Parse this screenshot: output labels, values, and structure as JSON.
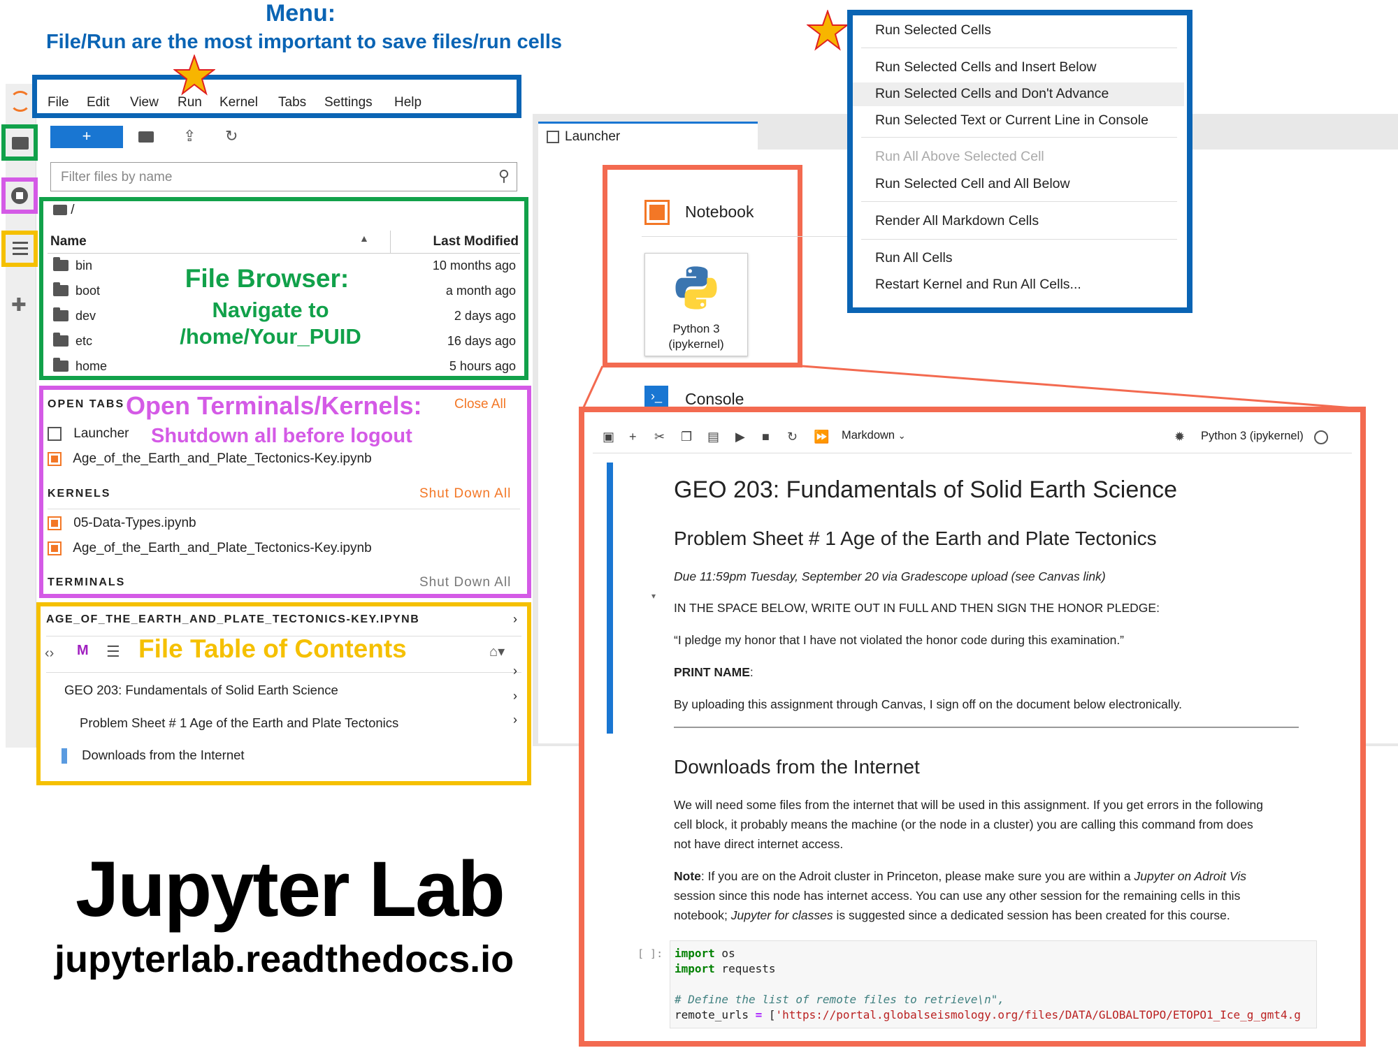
{
  "annotations": {
    "menu_title": "Menu:",
    "menu_subtitle": "File/Run are the most important to save files/run cells",
    "file_browser_title": "File Browser:",
    "file_browser_line1": "Navigate to",
    "file_browser_line2": "/home/Your_PUID",
    "terminals_title": "Open Terminals/Kernels:",
    "terminals_sub": "Shutdown all before logout",
    "toc_title": "File Table of Contents",
    "brand_title": "Jupyter Lab",
    "brand_url": "jupyterlab.readthedocs.io"
  },
  "menubar": [
    "File",
    "Edit",
    "View",
    "Run",
    "Kernel",
    "Tabs",
    "Settings",
    "Help"
  ],
  "file_browser": {
    "new_label": "+",
    "filter_placeholder": "Filter files by name",
    "path": "/",
    "col_name": "Name",
    "col_modified": "Last Modified",
    "files": [
      {
        "name": "bin",
        "modified": "10 months ago"
      },
      {
        "name": "boot",
        "modified": "a month ago"
      },
      {
        "name": "dev",
        "modified": "2 days ago"
      },
      {
        "name": "etc",
        "modified": "16 days ago"
      },
      {
        "name": "home",
        "modified": "5 hours ago"
      }
    ]
  },
  "running": {
    "open_tabs_header": "OPEN TABS",
    "close_all": "Close All",
    "open_tabs": [
      "Launcher",
      "Age_of_the_Earth_and_Plate_Tectonics-Key.ipynb"
    ],
    "kernels_header": "KERNELS",
    "shut_down_all": "Shut Down All",
    "kernels": [
      "05-Data-Types.ipynb",
      "Age_of_the_Earth_and_Plate_Tectonics-Key.ipynb"
    ],
    "terminals_header": "TERMINALS",
    "terminals_shutdown": "Shut Down All"
  },
  "toc": {
    "header": "AGE_OF_THE_EARTH_AND_PLATE_TECTONICS-KEY.IPYNB",
    "items": [
      "GEO 203: Fundamentals of Solid Earth Science",
      "Problem Sheet # 1 Age of the Earth and Plate Tectonics",
      "Downloads from the Internet"
    ]
  },
  "launcher": {
    "tab_label": "Launcher",
    "notebook_label": "Notebook",
    "kernel_line1": "Python 3",
    "kernel_line2": "(ipykernel)",
    "console_label": "Console"
  },
  "run_menu": {
    "items": [
      "Run Selected Cells",
      "Run Selected Cells and Insert Below",
      "Run Selected Cells and Don't Advance",
      "Run Selected Text or Current Line in Console",
      "Run All Above Selected Cell",
      "Run Selected Cell and All Below",
      "Render All Markdown Cells",
      "Run All Cells",
      "Restart Kernel and Run All Cells..."
    ]
  },
  "notebook": {
    "cell_type": "Markdown",
    "kernel_name": "Python 3 (ipykernel)",
    "h1": "GEO 203: Fundamentals of Solid Earth Science",
    "h2": "Problem Sheet # 1 Age of the Earth and Plate Tectonics",
    "due": "Due 11:59pm Tuesday, September 20 via Gradescope upload (see Canvas link)",
    "honor_instruction": "IN THE SPACE BELOW, WRITE OUT IN FULL AND THEN SIGN THE HONOR PLEDGE:",
    "pledge": "“I pledge my honor that I have not violated the honor code during this examination.”",
    "print_name": "PRINT NAME",
    "print_name_colon": ":",
    "uploading": "By uploading this assignment through Canvas, I sign off on the document below electronically.",
    "h2_downloads": "Downloads from the Internet",
    "para1_line1": "We will need some files from the internet that will be used in this assignment. If you get errors in the following",
    "para1_line2": "cell block, it probably means the machine (or the node in a cluster) you are calling this command from does",
    "para1_line3": "not have direct internet access.",
    "note_label": "Note",
    "note_line1a": ": If you are on the Adroit cluster in Princeton, please make sure you are within a ",
    "note_line1b": "Jupyter on Adroit Vis",
    "note_line2": "session since this node has internet access. You can use any other session for the remaining cells in this",
    "note_line3a": "notebook; ",
    "note_line3b": "Jupyter for classes",
    "note_line3c": " is suggested since a dedicated session has been created for this course.",
    "prompt": "[ ]:",
    "code_import": "import",
    "code_os": " os",
    "code_requests": " requests",
    "code_comment": "# Define the list of remote files to retrieve\\n\",",
    "code_var": "remote_urls ",
    "code_eq": "=",
    "code_bracket": " [",
    "code_url": "'https://portal.globalseismology.org/files/DATA/GLOBALTOPO/ETOPO1_Ice_g_gmt4.g"
  },
  "colors": {
    "blue": "#0a64b4",
    "green": "#11a14a",
    "purple": "#d45ae6",
    "yellow": "#f5c000",
    "orange": "#f36a50",
    "jp_orange": "#f37726"
  },
  "icons": [
    "folder-icon",
    "running-icon",
    "toc-icon",
    "extension-icon",
    "search-icon",
    "upload-icon",
    "refresh-icon",
    "star-icon",
    "python-logo-icon",
    "notebook-icon",
    "console-icon"
  ]
}
